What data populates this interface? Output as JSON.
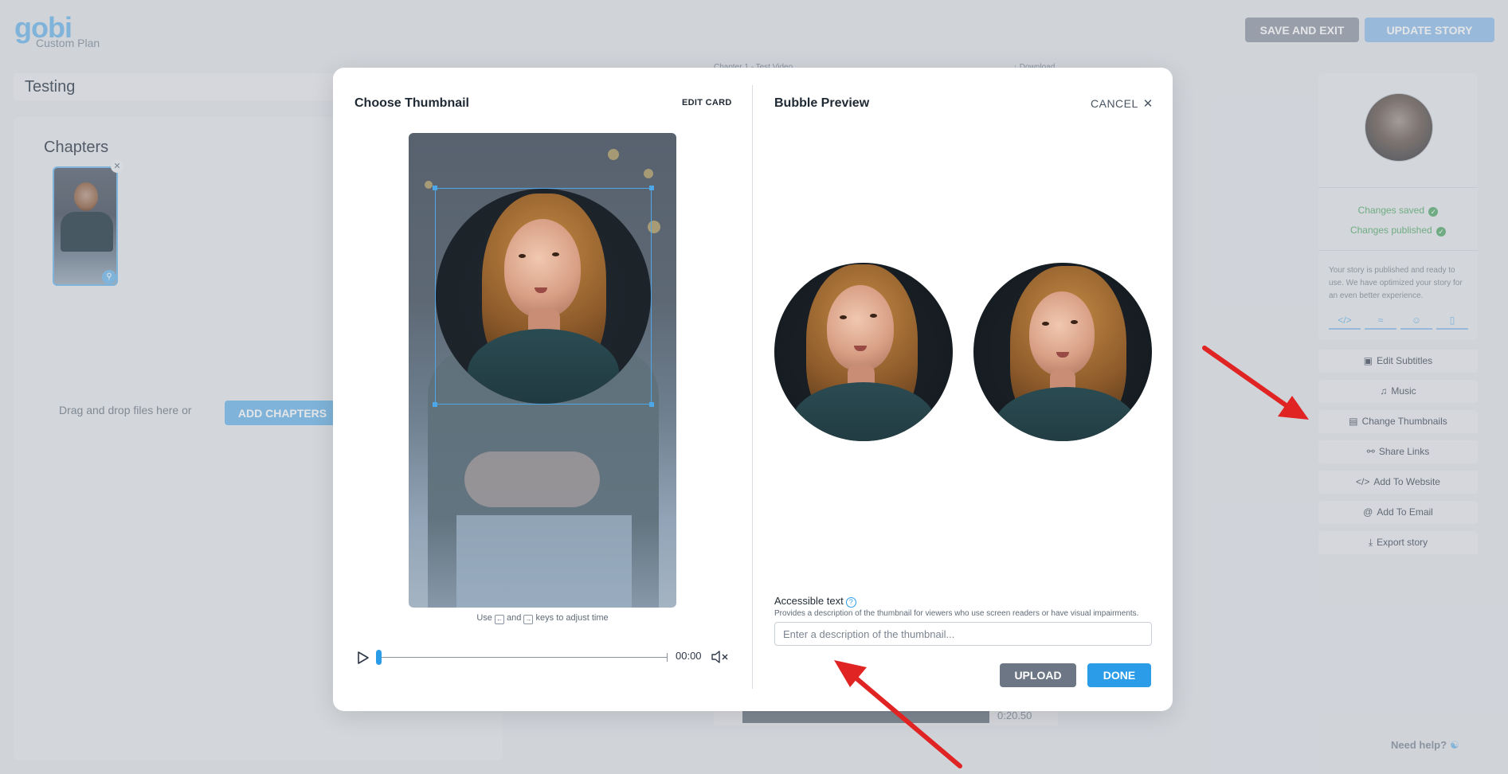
{
  "app": {
    "logo_text": "gobi",
    "plan_label": "Custom Plan",
    "save_exit_label": "SAVE AND EXIT",
    "update_story_label": "UPDATE STORY",
    "story_title": "Testing",
    "chapters_heading": "Chapters",
    "drop_text": "Drag and drop files here or",
    "add_chapters_label": "ADD CHAPTERS",
    "center_label_left": "Chapter 1 - Test Video",
    "center_label_right": "↓ Download",
    "timeline_time": "0:20.50"
  },
  "right_panel": {
    "status_saved": "Changes saved",
    "status_published": "Changes published",
    "published_note": "Your story is published and ready to use. We have optimized your story for an even better experience.",
    "mini_icons": [
      "code-icon",
      "wifi-icon",
      "smiley-icon",
      "phone-icon"
    ],
    "actions": [
      {
        "label": "Edit Subtitles",
        "icon": "subtitles-icon"
      },
      {
        "label": "Music",
        "icon": "music-icon"
      },
      {
        "label": "Change Thumbnails",
        "icon": "image-icon"
      },
      {
        "label": "Share Links",
        "icon": "share-icon"
      },
      {
        "label": "Add To Website",
        "icon": "code-icon"
      },
      {
        "label": "Add To Email",
        "icon": "at-icon"
      },
      {
        "label": "Export story",
        "icon": "download-icon"
      }
    ],
    "need_help": "Need help?"
  },
  "modal": {
    "left_title": "Choose Thumbnail",
    "edit_card_label": "EDIT CARD",
    "right_title": "Bubble Preview",
    "cancel_label": "CANCEL",
    "keys_hint_prefix": "Use",
    "keys_hint_and": "and",
    "keys_hint_suffix": "keys to adjust time",
    "time_display": "00:00",
    "scrubber_progress": 0.0,
    "accessible_label": "Accessible text",
    "accessible_help": "Provides a description of the thumbnail for viewers who use screen readers or have visual impairments.",
    "accessible_placeholder": "Enter a description of the thumbnail...",
    "accessible_value": "",
    "upload_label": "UPLOAD",
    "done_label": "DONE"
  },
  "colors": {
    "accent": "#2b9de8",
    "annotation_arrow": "#e02424",
    "status_green": "#7bbf8e"
  }
}
